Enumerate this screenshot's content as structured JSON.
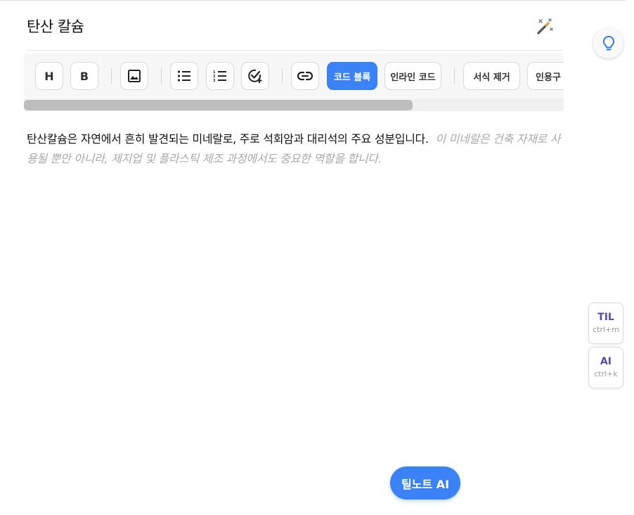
{
  "document": {
    "title": "탄산 칼슘",
    "body_text": "탄산칼슘은 자연에서 흔히 발견되는 미네랄로, 주로 석회암과 대리석의 주요 성분입니다.",
    "ai_suggestion": "이 미네랄은 건축 자재로 사용될 뿐만 아니라, 제지업 및 플라스틱 제조 과정에서도 중요한 역할을 합니다."
  },
  "toolbar": {
    "heading_label": "H",
    "bold_label": "B",
    "code_block_label": "코드 블록",
    "inline_code_label": "인라인 코드",
    "clear_format_label": "서식 제거",
    "quote_label": "인용구",
    "scroll_position": 0.72
  },
  "side_panel": {
    "til_label": "TIL",
    "til_shortcut": "ctrl+m",
    "ai_label": "AI",
    "ai_shortcut": "ctrl+k"
  },
  "floating": {
    "ai_button_label": "틸노트 AI"
  },
  "colors": {
    "accent": "#3b82f6",
    "side_label": "#5b4aa8",
    "suggestion_text": "#a8a8a8"
  },
  "icons": [
    "magic-wand-icon",
    "image-icon",
    "bullet-list-icon",
    "numbered-list-icon",
    "check-add-icon",
    "link-icon",
    "lightbulb-icon"
  ]
}
